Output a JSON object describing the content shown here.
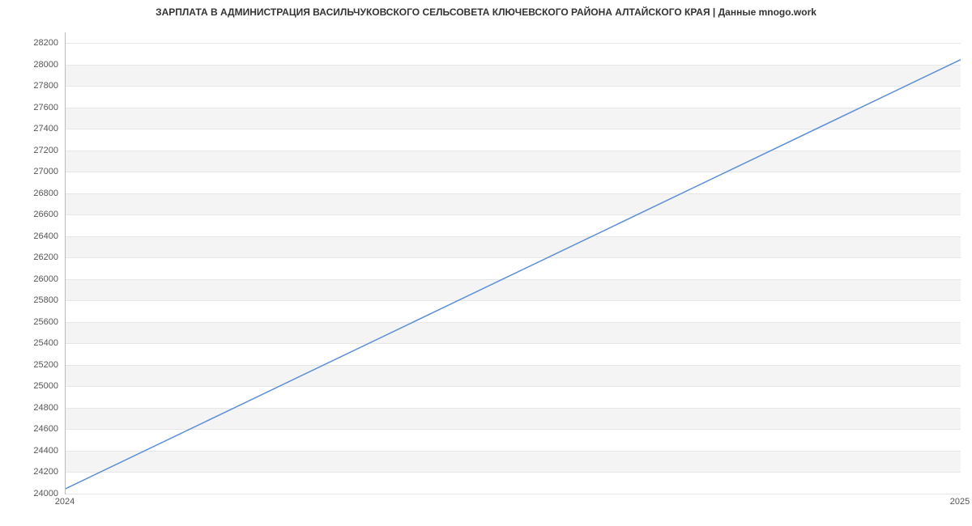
{
  "chart_data": {
    "type": "line",
    "title": "ЗАРПЛАТА В АДМИНИСТРАЦИЯ ВАСИЛЬЧУКОВСКОГО СЕЛЬСОВЕТА КЛЮЧЕВСКОГО РАЙОНА АЛТАЙСКОГО КРАЯ | Данные mnogo.work",
    "x": [
      2024,
      2025
    ],
    "values": [
      24046,
      28046
    ],
    "xlabel": "",
    "ylabel": "",
    "xticks": [
      2024,
      2025
    ],
    "yticks": [
      24000,
      24200,
      24400,
      24600,
      24800,
      25000,
      25200,
      25400,
      25600,
      25800,
      26000,
      26200,
      26400,
      26600,
      26800,
      27000,
      27200,
      27400,
      27600,
      27800,
      28000,
      28200
    ],
    "ylim": [
      24000,
      28300
    ],
    "xlim": [
      2024,
      2025
    ],
    "line_color": "#5b8ed6"
  }
}
